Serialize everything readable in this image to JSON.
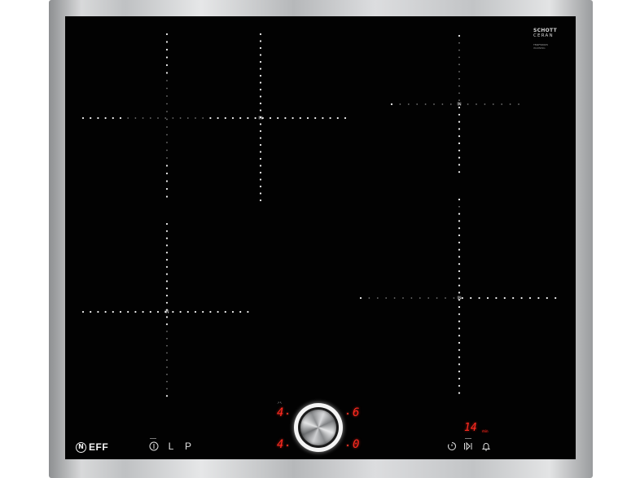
{
  "appliance": {
    "glass_brand_line1": "SCHOTT",
    "glass_brand_line2": "CERAN",
    "glass_fine_print1": "TM4F5D005",
    "glass_fine_print2": "WARNING",
    "brand_mark": "N",
    "brand_name": "EFF"
  },
  "zone_marker": "IN",
  "controls": {
    "power_icon": "power-icon",
    "lock_label": "L",
    "power_management_label": "P",
    "timer_icon": "timer-icon",
    "start_stop_icon": "play-pause-icon",
    "alarm_icon": "bell-icon"
  },
  "displays": {
    "top_left_level": "4",
    "top_right_level": "6",
    "bottom_left_level": "4",
    "bottom_right_level": "0",
    "timer_value": "14",
    "timer_small_label": "min"
  },
  "colors": {
    "glass": "#020202",
    "led_red": "#ff2a1f",
    "dot_white": "#ffffff",
    "frame_steel": "#c2c4c6"
  }
}
